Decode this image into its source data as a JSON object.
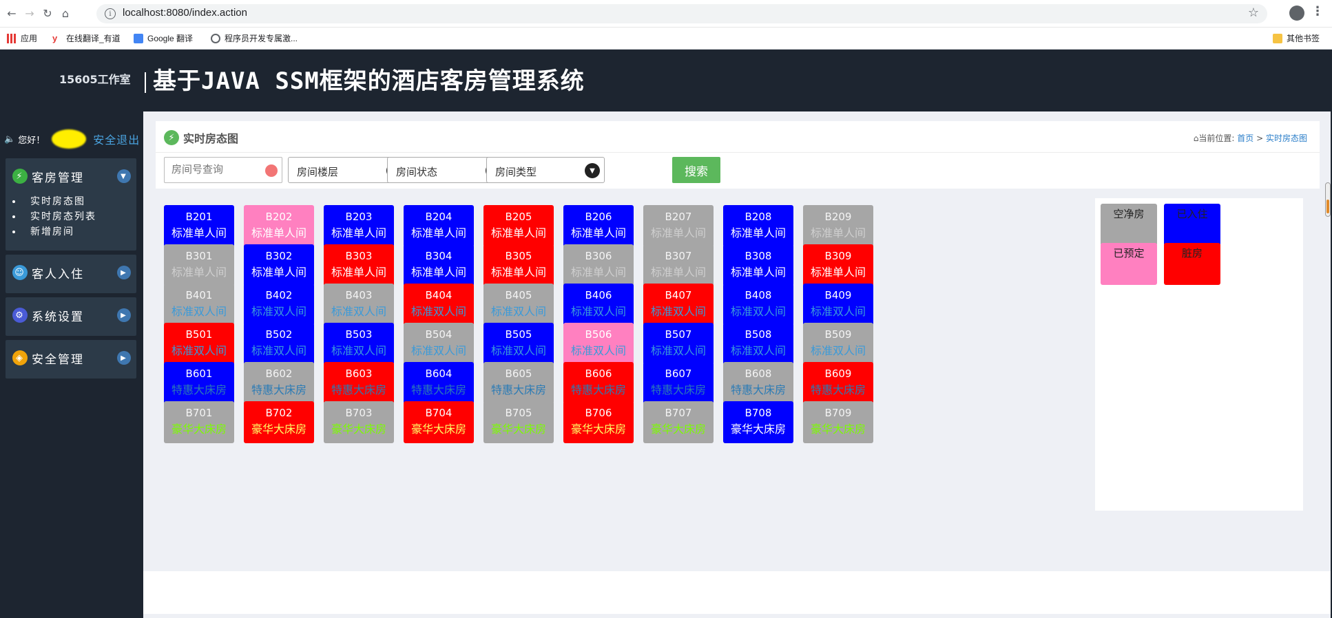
{
  "browser": {
    "url": "localhost:8080/index.action",
    "bookmarks": [
      "应用",
      "在线翻译_有道",
      "Google 翻译",
      "程序员开发专属激...",
      "其他书签"
    ]
  },
  "header": {
    "studio": "15605工作室",
    "title": "基于JAVA SSM框架的酒店客房管理系统"
  },
  "sidebar": {
    "greeting": "您好！",
    "logout": "安全退出",
    "groups": [
      {
        "label": "客房管理",
        "items": [
          "实时房态图",
          "实时房态列表",
          "新增房间"
        ]
      },
      {
        "label": "客人入住"
      },
      {
        "label": "系统设置"
      },
      {
        "label": "安全管理"
      }
    ]
  },
  "panel": {
    "title": "实时房态图",
    "crumb_prefix": "当前位置:",
    "crumb_home": "首页",
    "crumb_sep": ">",
    "crumb_current": "实时房态图"
  },
  "toolbar": {
    "search_placeholder": "房间号查询",
    "floor": "房间楼层",
    "status": "房间状态",
    "type": "房间类型",
    "search_button": "搜索"
  },
  "colors": {
    "blue": "#0000ff",
    "pink": "#ff80c0",
    "red": "#ff0000",
    "gray": "#a6a6a6"
  },
  "rooms": [
    [
      [
        "B201",
        "标准单人间",
        "blue"
      ],
      [
        "B202",
        "标准单人间",
        "pink"
      ],
      [
        "B203",
        "标准单人间",
        "blue"
      ],
      [
        "B204",
        "标准单人间",
        "blue"
      ],
      [
        "B205",
        "标准单人间",
        "red"
      ],
      [
        "B206",
        "标准单人间",
        "blue"
      ],
      [
        "B207",
        "标准单人间",
        "gray"
      ],
      [
        "B208",
        "标准单人间",
        "blue"
      ],
      [
        "B209",
        "标准单人间",
        "gray"
      ]
    ],
    [
      [
        "B301",
        "标准单人间",
        "gray"
      ],
      [
        "B302",
        "标准单人间",
        "blue"
      ],
      [
        "B303",
        "标准单人间",
        "red"
      ],
      [
        "B304",
        "标准单人间",
        "blue"
      ],
      [
        "B305",
        "标准单人间",
        "red"
      ],
      [
        "B306",
        "标准单人间",
        "gray"
      ],
      [
        "B307",
        "标准单人间",
        "gray"
      ],
      [
        "B308",
        "标准单人间",
        "blue"
      ],
      [
        "B309",
        "标准单人间",
        "red"
      ]
    ],
    [
      [
        "B401",
        "标准双人间",
        "gray"
      ],
      [
        "B402",
        "标准双人间",
        "blue"
      ],
      [
        "B403",
        "标准双人间",
        "gray"
      ],
      [
        "B404",
        "标准双人间",
        "red"
      ],
      [
        "B405",
        "标准双人间",
        "gray"
      ],
      [
        "B406",
        "标准双人间",
        "blue"
      ],
      [
        "B407",
        "标准双人间",
        "red"
      ],
      [
        "B408",
        "标准双人间",
        "blue"
      ],
      [
        "B409",
        "标准双人间",
        "blue"
      ]
    ],
    [
      [
        "B501",
        "标准双人间",
        "red"
      ],
      [
        "B502",
        "标准双人间",
        "blue"
      ],
      [
        "B503",
        "标准双人间",
        "blue"
      ],
      [
        "B504",
        "标准双人间",
        "gray"
      ],
      [
        "B505",
        "标准双人间",
        "blue"
      ],
      [
        "B506",
        "标准双人间",
        "pink"
      ],
      [
        "B507",
        "标准双人间",
        "blue"
      ],
      [
        "B508",
        "标准双人间",
        "blue"
      ],
      [
        "B509",
        "标准双人间",
        "gray"
      ]
    ],
    [
      [
        "B601",
        "特惠大床房",
        "blue"
      ],
      [
        "B602",
        "特惠大床房",
        "gray"
      ],
      [
        "B603",
        "特惠大床房",
        "red"
      ],
      [
        "B604",
        "特惠大床房",
        "blue"
      ],
      [
        "B605",
        "特惠大床房",
        "gray"
      ],
      [
        "B606",
        "特惠大床房",
        "red"
      ],
      [
        "B607",
        "特惠大床房",
        "blue"
      ],
      [
        "B608",
        "特惠大床房",
        "gray"
      ],
      [
        "B609",
        "特惠大床房",
        "red"
      ]
    ],
    [
      [
        "B701",
        "豪华大床房",
        "gray"
      ],
      [
        "B702",
        "豪华大床房",
        "red"
      ],
      [
        "B703",
        "豪华大床房",
        "gray"
      ],
      [
        "B704",
        "豪华大床房",
        "red"
      ],
      [
        "B705",
        "豪华大床房",
        "gray"
      ],
      [
        "B706",
        "豪华大床房",
        "red"
      ],
      [
        "B707",
        "豪华大床房",
        "gray"
      ],
      [
        "B708",
        "豪华大床房",
        "blue"
      ],
      [
        "B709",
        "豪华大床房",
        "gray"
      ]
    ]
  ],
  "room_type_text_colors": {
    "标准单人间": "#cfcfcf",
    "标准双人间": "#3a9ad9",
    "特惠大床房": "#2b7bb5",
    "豪华大床房": "#7cfc00"
  },
  "legend": [
    {
      "label": "空净房",
      "color": "gray"
    },
    {
      "label": "已入住",
      "color": "blue"
    },
    {
      "label": "已预定",
      "color": "pink"
    },
    {
      "label": "脏房",
      "color": "red"
    }
  ]
}
